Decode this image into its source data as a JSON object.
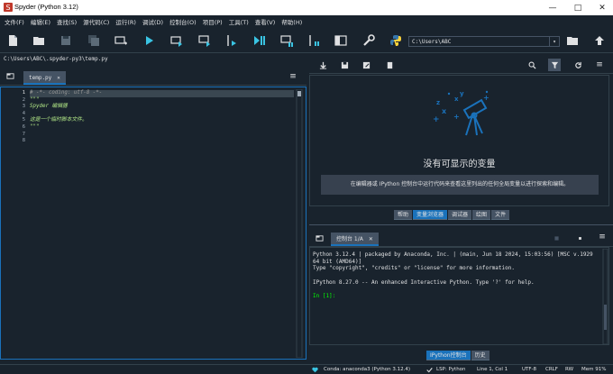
{
  "window": {
    "title": "Spyder (Python 3.12)"
  },
  "menu": [
    "文件(F)",
    "编辑(E)",
    "查找(S)",
    "源代码(C)",
    "运行(R)",
    "调试(D)",
    "控制台(O)",
    "项目(P)",
    "工具(T)",
    "查看(V)",
    "帮助(H)"
  ],
  "toolbar": {
    "path_value": "C:\\Users\\ABC",
    "icons": [
      "new-file",
      "open-file",
      "save-file",
      "save-all",
      "create-cell",
      "run",
      "run-cell",
      "run-cell-advance",
      "run-selection",
      "debug",
      "debug-cell",
      "debug-selection",
      "maximize-pane",
      "preferences",
      "python-path",
      "browse-folder",
      "parent-folder"
    ]
  },
  "editor": {
    "file_path": "C:\\Users\\ABC\\.spyder-py3\\temp.py",
    "tab_label": "temp.py",
    "line_numbers": [
      "1",
      "2",
      "3",
      "4",
      "5",
      "6",
      "7",
      "8"
    ],
    "lines": [
      "# -*- coding: utf-8 -*-",
      "\"\"\"",
      "Spyder 编辑器",
      "",
      "这是一个临时脚本文件。",
      "\"\"\"",
      "",
      ""
    ]
  },
  "variable_explorer": {
    "empty_title": "没有可显示的变量",
    "empty_message": "在编辑器或 IPython 控制台中运行代码来查看这里列出的任何全局变量以进行探索和编辑。",
    "tabs": [
      "帮助",
      "变量浏览器",
      "调试器",
      "绘图",
      "文件"
    ],
    "active_tab": "变量浏览器"
  },
  "console": {
    "tab_label": "控制台 1/A",
    "lines": [
      "Python 3.12.4 | packaged by Anaconda, Inc. | (main, Jun 18 2024, 15:03:56) [MSC v.1929 64 bit (AMD64)]",
      "Type \"copyright\", \"credits\" or \"license\" for more information.",
      "",
      "IPython 8.27.0 -- An enhanced Interactive Python. Type '?' for help.",
      ""
    ],
    "prompt": "In [1]:",
    "tabs": [
      "IPython控制台",
      "历史"
    ],
    "active_tab": "IPython控制台"
  },
  "statusbar": {
    "conda": "Conda: anaconda3 (Python 3.12.4)",
    "lsp": "LSP: Python",
    "position": "Line 1, Col 1",
    "encoding": "UTF-8",
    "eol": "CRLF",
    "permissions": "RW",
    "memory": "Mem 91%"
  },
  "colors": {
    "background": "#19232d",
    "accent": "#1a72bb",
    "string": "#b0e686",
    "comment": "#999999",
    "prompt": "#00ff00"
  }
}
